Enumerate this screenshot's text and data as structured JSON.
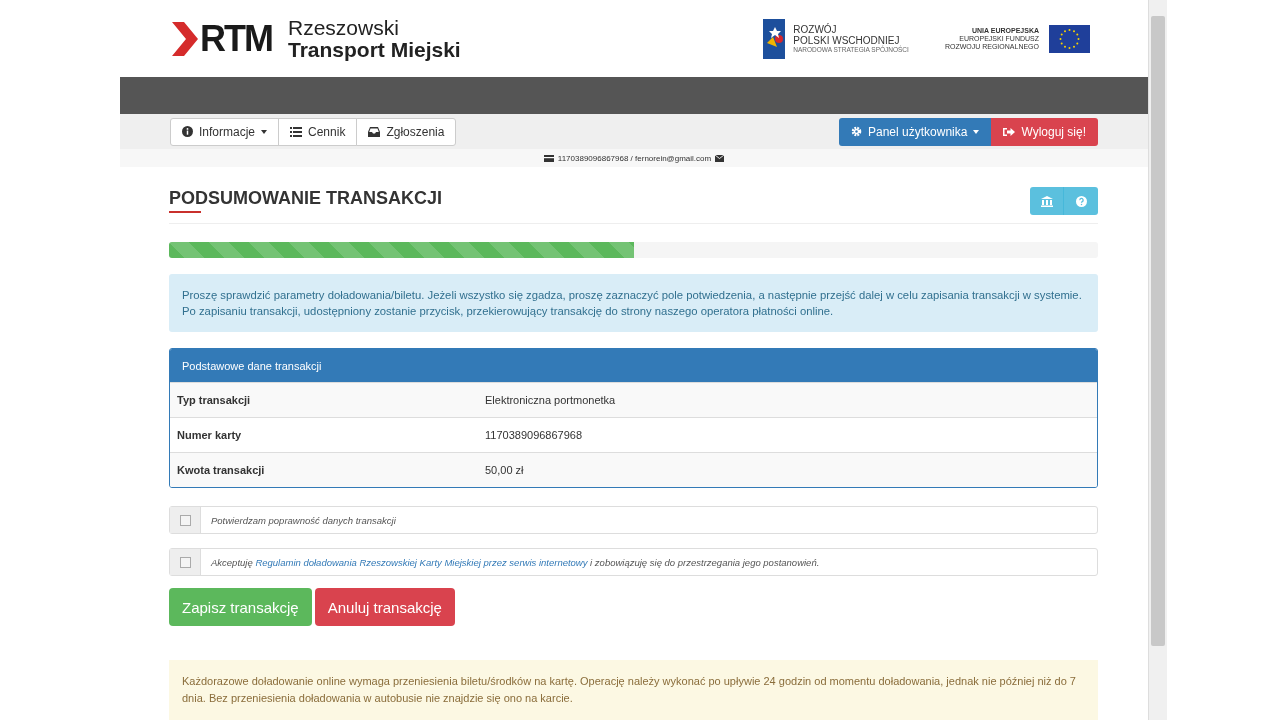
{
  "header": {
    "logo_mark": "RTM",
    "logo_line1": "Rzeszowski",
    "logo_line2": "Transport Miejski",
    "partner1": {
      "line1": "ROZWÓJ",
      "line2": "POLSKI WSCHODNIEJ",
      "line3": "NARODOWA STRATEGIA SPÓJNOŚCI"
    },
    "partner2": {
      "line1": "UNIA EUROPEJSKA",
      "line2": "EUROPEJSKI FUNDUSZ",
      "line3": "ROZWOJU REGIONALNEGO"
    }
  },
  "nav": {
    "left": [
      {
        "label": "Informacje",
        "caret": true
      },
      {
        "label": "Cennik",
        "caret": false
      },
      {
        "label": "Zgłoszenia",
        "caret": false
      }
    ],
    "right": [
      {
        "label": "Panel użytkownika",
        "kind": "primary",
        "caret": true
      },
      {
        "label": "Wyloguj się!",
        "kind": "danger",
        "caret": false
      }
    ]
  },
  "user_info": {
    "card": "1170389096867968",
    "separator": "/",
    "email": "fernorein@gmail.com"
  },
  "title": "PODSUMOWANIE TRANSAKCJI",
  "progress": {
    "level": 0.5
  },
  "info": "Proszę sprawdzić parametry doładowania/biletu. Jeżeli wszystko się zgadza, proszę zaznaczyć pole potwiedzenia, a następnie przejść dalej w celu zapisania transakcji w systemie. Po zapisaniu transakcji, udostępniony zostanie przycisk, przekierowujący transakcję do strony naszego operatora płatności online.",
  "table": {
    "heading": "Podstawowe dane transakcji",
    "rows": [
      {
        "label": "Typ transakcji",
        "value": "Elektroniczna portmonetka"
      },
      {
        "label": "Numer karty",
        "value": "1170389096867968"
      },
      {
        "label": "Kwota transakcji",
        "value": "50,00 zł"
      }
    ]
  },
  "confirmations": [
    {
      "checked": false,
      "text": "Potwierdzam poprawność danych transakcji"
    },
    {
      "checked": false,
      "text": "Akceptuję ",
      "link": "Regulamin doładowania Rzeszowskiej Karty Miejskiej przez serwis internetowy",
      "text_after": " i zobowiązuję się do przestrzegania jego postanowień."
    }
  ],
  "buttons": [
    {
      "label": "Zapisz transakcję",
      "kind": "success"
    },
    {
      "label": "Anuluj transakcję",
      "kind": "danger"
    }
  ],
  "notice": "Każdorazowe doładowanie online wymaga przeniesienia biletu/środków na kartę. Operację należy wykonać po upływie 24 godzin od momentu doładowania, jednak nie później niż do 7 dnia. Bez przeniesienia doładowania w autobusie nie znajdzie się ono na karcie."
}
